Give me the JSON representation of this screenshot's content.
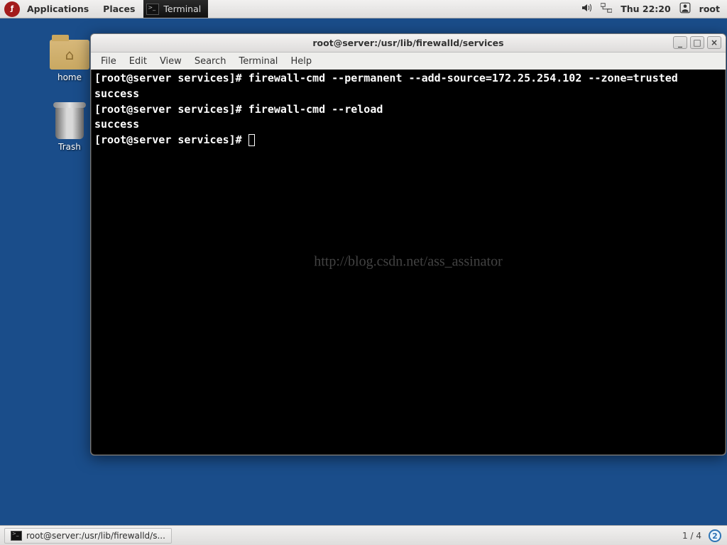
{
  "top_panel": {
    "applications": "Applications",
    "places": "Places",
    "active_app": "Terminal",
    "clock": "Thu 22:20",
    "user": "root"
  },
  "desktop": {
    "home_label": "home",
    "trash_label": "Trash"
  },
  "window": {
    "title": "root@server:/usr/lib/firewalld/services",
    "menu": {
      "file": "File",
      "edit": "Edit",
      "view": "View",
      "search": "Search",
      "terminal": "Terminal",
      "help": "Help"
    }
  },
  "terminal": {
    "prompt": "[root@server services]# ",
    "cmd1": "firewall-cmd --permanent --add-source=172.25.254.102 --zone=trusted",
    "out1": "success",
    "cmd2": "firewall-cmd --reload",
    "out2": "success",
    "watermark": "http://blog.csdn.net/ass_assinator"
  },
  "bottom_panel": {
    "task": "root@server:/usr/lib/firewalld/s...",
    "workspace": "1 / 4",
    "badge": "2"
  }
}
